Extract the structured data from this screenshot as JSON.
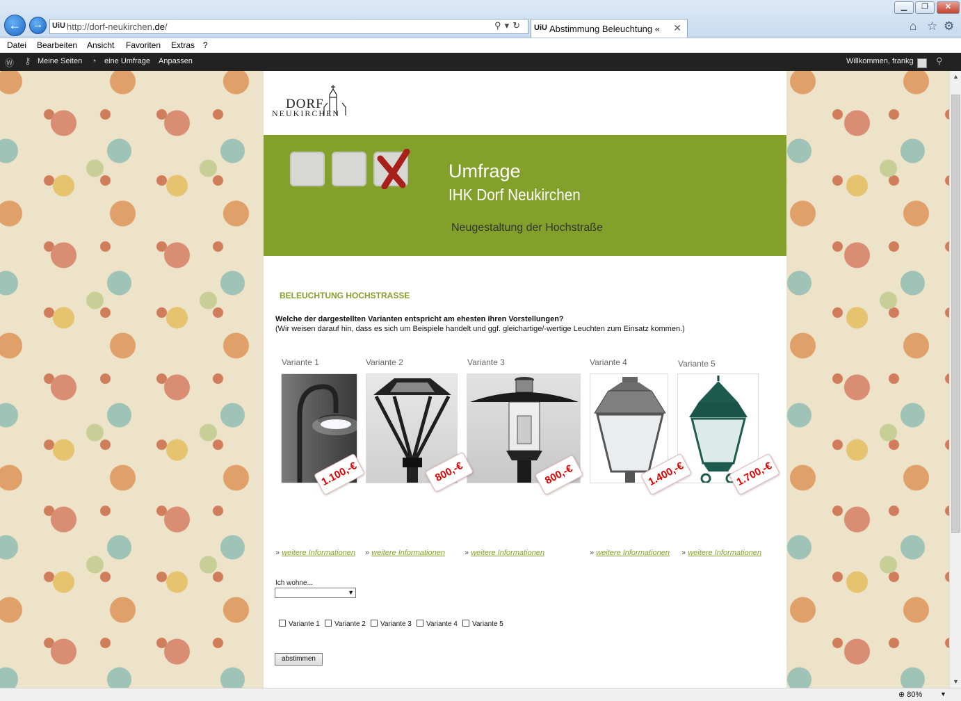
{
  "browser": {
    "url_prefix": "http://dorf-neukirchen",
    "url_host": ".de",
    "url_suffix": "/",
    "site_icon": "UiU",
    "tab_icon": "UiU",
    "tab_title": "Abstimmung Beleuchtung «",
    "tab_close": "✕",
    "window_buttons": {
      "min": "▁",
      "max": "❐",
      "close": "✕"
    },
    "icons": [
      "back-icon",
      "forward-icon",
      "search-icon",
      "refresh-icon",
      "home-icon",
      "star-icon",
      "gear-icon"
    ]
  },
  "menu": [
    "Datei",
    "Bearbeiten",
    "Ansicht",
    "Favoriten",
    "Extras",
    "?"
  ],
  "adminbar": {
    "my_sites": "Meine Seiten",
    "site_name": "eine Umfrage",
    "customize": "Anpassen",
    "welcome": "Willkommen, frankg"
  },
  "site": {
    "logo_line1": "DORF",
    "logo_line2": "NEUKIRCHEN",
    "banner_title": "Umfrage",
    "banner_subtitle": "IHK Dorf Neukirchen",
    "banner_line": "Neugestaltung der Hochstraße",
    "banner_color": "#83a02a",
    "section_title": "BELEUCHTUNG HOCHSTRASSE",
    "question": "Welche der dargestellten Varianten entspricht am ehesten Ihren Vorstellungen?",
    "hint": "(Wir weisen darauf hin, dass  es sich um Beispiele handelt und ggf. gleichartige/-wertige Leuchten zum Einsatz kommen.)",
    "variants": [
      {
        "label": "Variante 1",
        "price": "1.100,-€",
        "more_prefix": "»",
        "more": "weitere Informationen"
      },
      {
        "label": "Variante 2",
        "price": "800,-€",
        "more_prefix": "»",
        "more": "weitere Informationen"
      },
      {
        "label": "Variante 3",
        "price": "800,-€",
        "more_prefix": "»",
        "more": "weitere Informationen"
      },
      {
        "label": "Variante 4",
        "price": "1.400,-€",
        "more_prefix": "»",
        "more": "weitere Informationen"
      },
      {
        "label": "Variante 5",
        "price": "1.700,-€",
        "more_prefix": "»",
        "more": "weitere Informationen"
      }
    ],
    "wohne_label": "Ich wohne...",
    "wohne_value": "",
    "checkboxes": [
      "Variante 1",
      "Variante 2",
      "Variante 3",
      "Variante 4",
      "Variante 5"
    ],
    "submit": "abstimmen"
  },
  "status": {
    "zoom": "80%"
  }
}
